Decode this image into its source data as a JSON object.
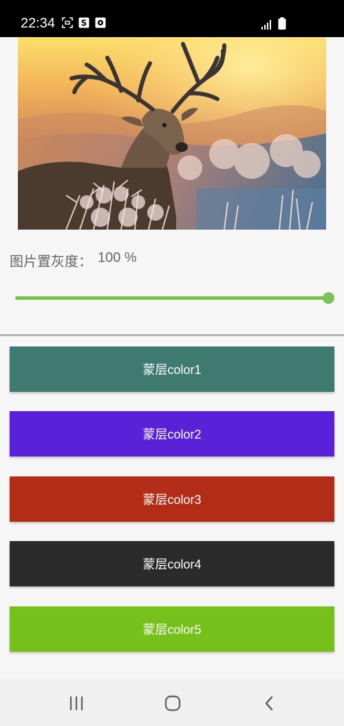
{
  "status_bar": {
    "time": "22:34",
    "left_icons": [
      "screenshot-icon",
      "s-app-icon",
      "record-icon"
    ],
    "right_icons": [
      "signal-icon",
      "battery-icon"
    ]
  },
  "hero_image": {
    "subject": "deer-photo"
  },
  "grayscale": {
    "label": "图片置灰度：",
    "value": "100 %",
    "level": 1.0,
    "accent": "#76c043"
  },
  "overlay_buttons": [
    {
      "label": "蒙层color1",
      "color": "#3e7a6f"
    },
    {
      "label": "蒙层color2",
      "color": "#5a22d8"
    },
    {
      "label": "蒙层color3",
      "color": "#b32c18"
    },
    {
      "label": "蒙层color4",
      "color": "#2b2b2b"
    },
    {
      "label": "蒙层color5",
      "color": "#76c01b"
    }
  ],
  "nav_bar": {
    "icons": [
      "recent-apps-icon",
      "home-icon",
      "back-icon"
    ]
  }
}
